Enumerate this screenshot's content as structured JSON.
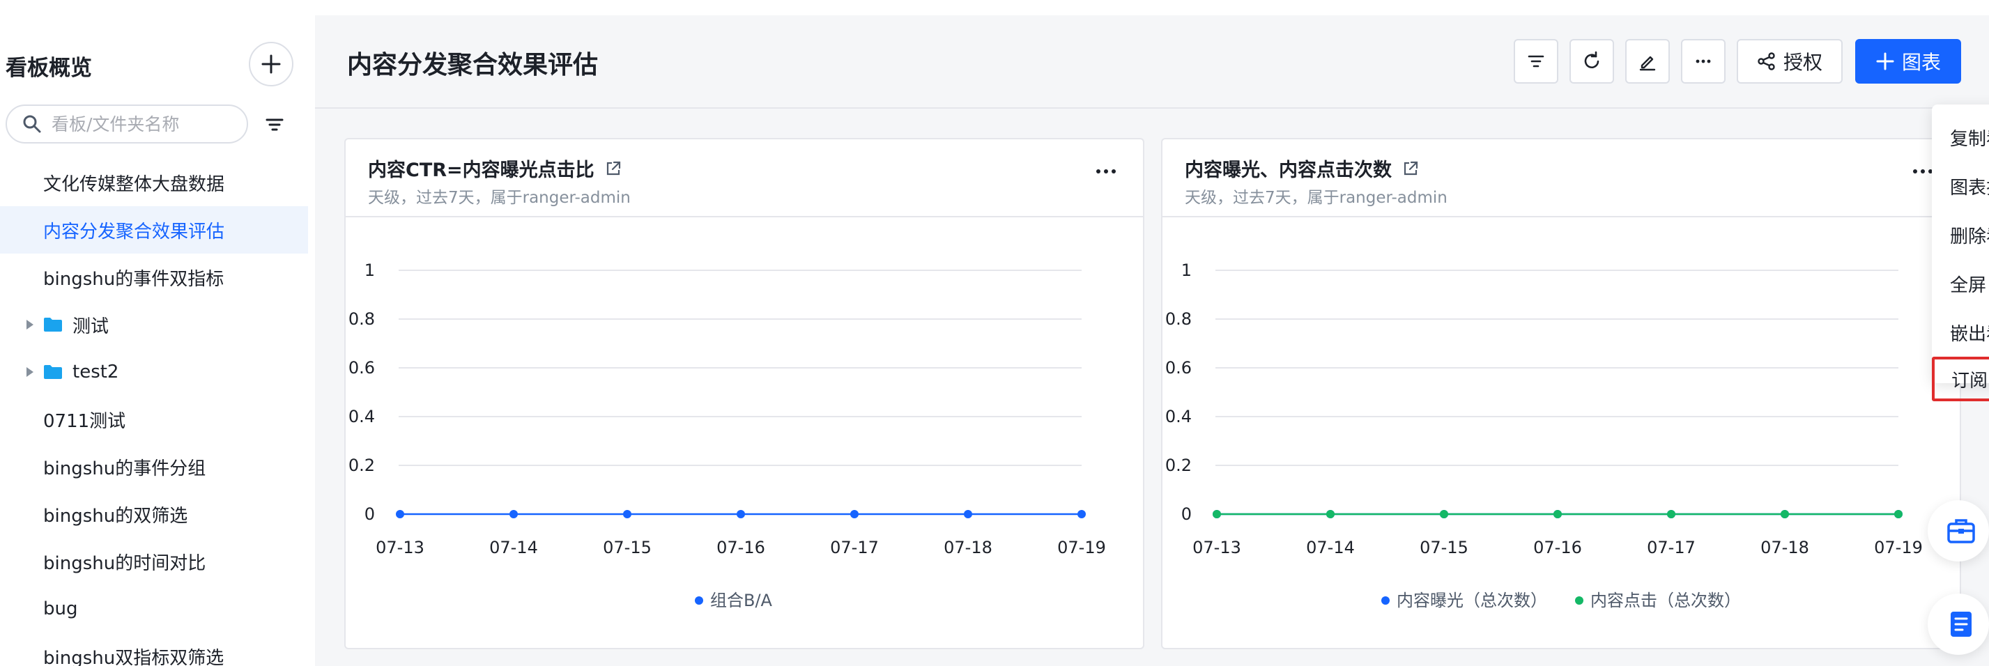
{
  "sidebar": {
    "title": "看板概览",
    "search_placeholder": "看板/文件夹名称",
    "items": [
      {
        "label": "文化传媒整体大盘数据",
        "type": "board",
        "active": false
      },
      {
        "label": "内容分发聚合效果评估",
        "type": "board",
        "active": true
      },
      {
        "label": "bingshu的事件双指标",
        "type": "board",
        "active": false
      },
      {
        "label": "测试",
        "type": "folder",
        "active": false
      },
      {
        "label": "test2",
        "type": "folder",
        "active": false
      },
      {
        "label": "0711测试",
        "type": "board",
        "active": false
      },
      {
        "label": "bingshu的事件分组",
        "type": "board",
        "active": false
      },
      {
        "label": "bingshu的双筛选",
        "type": "board",
        "active": false
      },
      {
        "label": "bingshu的时间对比",
        "type": "board",
        "active": false
      },
      {
        "label": "bug",
        "type": "board",
        "active": false
      },
      {
        "label": "bingshu双指标双筛选",
        "type": "board",
        "active": false
      }
    ]
  },
  "header": {
    "title": "内容分发聚合效果评估",
    "auth_label": "授权",
    "add_chart_label": "图表"
  },
  "dropdown": {
    "items": [
      "复制看板",
      "图表排序",
      "删除看板",
      "全屏",
      "嵌出看板",
      "订阅"
    ],
    "highlighted": "订阅"
  },
  "cards": [
    {
      "title": "内容CTR=内容曝光点击比",
      "subtitle": "天级，过去7天，属于ranger-admin"
    },
    {
      "title": "内容曝光、内容点击次数",
      "subtitle": "天级，过去7天，属于ranger-admin"
    }
  ],
  "colors": {
    "primary": "#1664ff",
    "series_blue": "#1664ff",
    "series_green": "#14b866",
    "highlight_border": "#e02d2d"
  },
  "chart_data": [
    {
      "type": "line",
      "categories": [
        "07-13",
        "07-14",
        "07-15",
        "07-16",
        "07-17",
        "07-18",
        "07-19"
      ],
      "yticks": [
        0,
        0.2,
        0.4,
        0.6,
        0.8,
        1
      ],
      "ylim": [
        0,
        1
      ],
      "grid": true,
      "legend": "bottom",
      "series": [
        {
          "name": "组合B/A",
          "color": "#1664ff",
          "values": [
            0,
            0,
            0,
            0,
            0,
            0,
            0
          ]
        }
      ]
    },
    {
      "type": "line",
      "categories": [
        "07-13",
        "07-14",
        "07-15",
        "07-16",
        "07-17",
        "07-18",
        "07-19"
      ],
      "yticks": [
        0,
        0.2,
        0.4,
        0.6,
        0.8,
        1
      ],
      "ylim": [
        0,
        1
      ],
      "grid": true,
      "legend": "bottom",
      "series": [
        {
          "name": "内容曝光（总次数）",
          "color": "#1664ff",
          "values": [
            0,
            0,
            0,
            0,
            0,
            0,
            0
          ]
        },
        {
          "name": "内容点击（总次数）",
          "color": "#14b866",
          "values": [
            0,
            0,
            0,
            0,
            0,
            0,
            0
          ]
        }
      ]
    }
  ]
}
